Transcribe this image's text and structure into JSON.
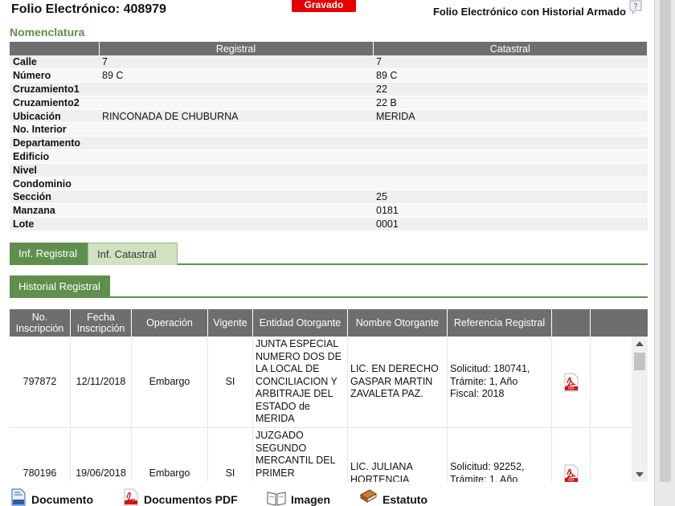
{
  "header": {
    "folio_title": "Folio Electrónico: 408979",
    "status_badge": "Gravado",
    "historial_armado": "Folio Electrónico con Historial Armado"
  },
  "nomenclatura": {
    "heading": "Nomenclatura",
    "columns": [
      "Registral",
      "Catastral"
    ],
    "rows": [
      {
        "label": "Calle",
        "registral": "7",
        "catastral": "7"
      },
      {
        "label": "Número",
        "registral": "89 C",
        "catastral": "89 C"
      },
      {
        "label": "Cruzamiento1",
        "registral": "",
        "catastral": "22"
      },
      {
        "label": "Cruzamiento2",
        "registral": "",
        "catastral": "22 B"
      },
      {
        "label": "Ubicación",
        "registral": "RINCONADA DE CHUBURNA",
        "catastral": "MERIDA"
      },
      {
        "label": "No. Interior",
        "registral": "",
        "catastral": ""
      },
      {
        "label": "Departamento",
        "registral": "",
        "catastral": ""
      },
      {
        "label": "Edificio",
        "registral": "",
        "catastral": ""
      },
      {
        "label": "Nivel",
        "registral": "",
        "catastral": ""
      },
      {
        "label": "Condominio",
        "registral": "",
        "catastral": ""
      },
      {
        "label": "Sección",
        "registral": "",
        "catastral": "25"
      },
      {
        "label": "Manzana",
        "registral": "",
        "catastral": "0181"
      },
      {
        "label": "Lote",
        "registral": "",
        "catastral": "0001"
      }
    ]
  },
  "tabs": {
    "inf_registral": "Inf. Registral",
    "inf_catastral": "Inf. Catastral",
    "historial_registral": "Historial Registral"
  },
  "historial": {
    "columns": [
      "No. Inscripción",
      "Fecha Inscripción",
      "Operación",
      "Vigente",
      "Entidad Otorgante",
      "Nombre Otorgante",
      "Referencia Registral"
    ],
    "rows": [
      {
        "no_inscripcion": "797872",
        "fecha": "12/11/2018",
        "operacion": "Embargo",
        "vigente": "SI",
        "entidad": "JUNTA ESPECIAL NUMERO DOS DE LA LOCAL DE CONCILIACION Y ARBITRAJE DEL ESTADO de MERIDA",
        "nombre": "LIC. EN DERECHO GASPAR MARTIN ZAVALETA PAZ.",
        "referencia": "Solicitud: 180741, Trámite: 1, Año Fiscal: 2018"
      },
      {
        "no_inscripcion": "780196",
        "fecha": "19/06/2018",
        "operacion": "Embargo",
        "vigente": "SI",
        "entidad": "JUZGADO SEGUNDO MERCANTIL DEL PRIMER",
        "nombre": "LIC. JULIANA HORTENCIA",
        "referencia": "Solicitud: 92252, Trámite: 1, Año"
      }
    ]
  },
  "toolbar": {
    "documento": "Documento",
    "documentos_pdf": "Documentos PDF",
    "imagen": "Imagen",
    "estatuto": "Estatuto"
  },
  "colors": {
    "accent_green": "#5e8f4c",
    "header_gray": "#6e6e6e",
    "badge_red": "#e60000"
  }
}
